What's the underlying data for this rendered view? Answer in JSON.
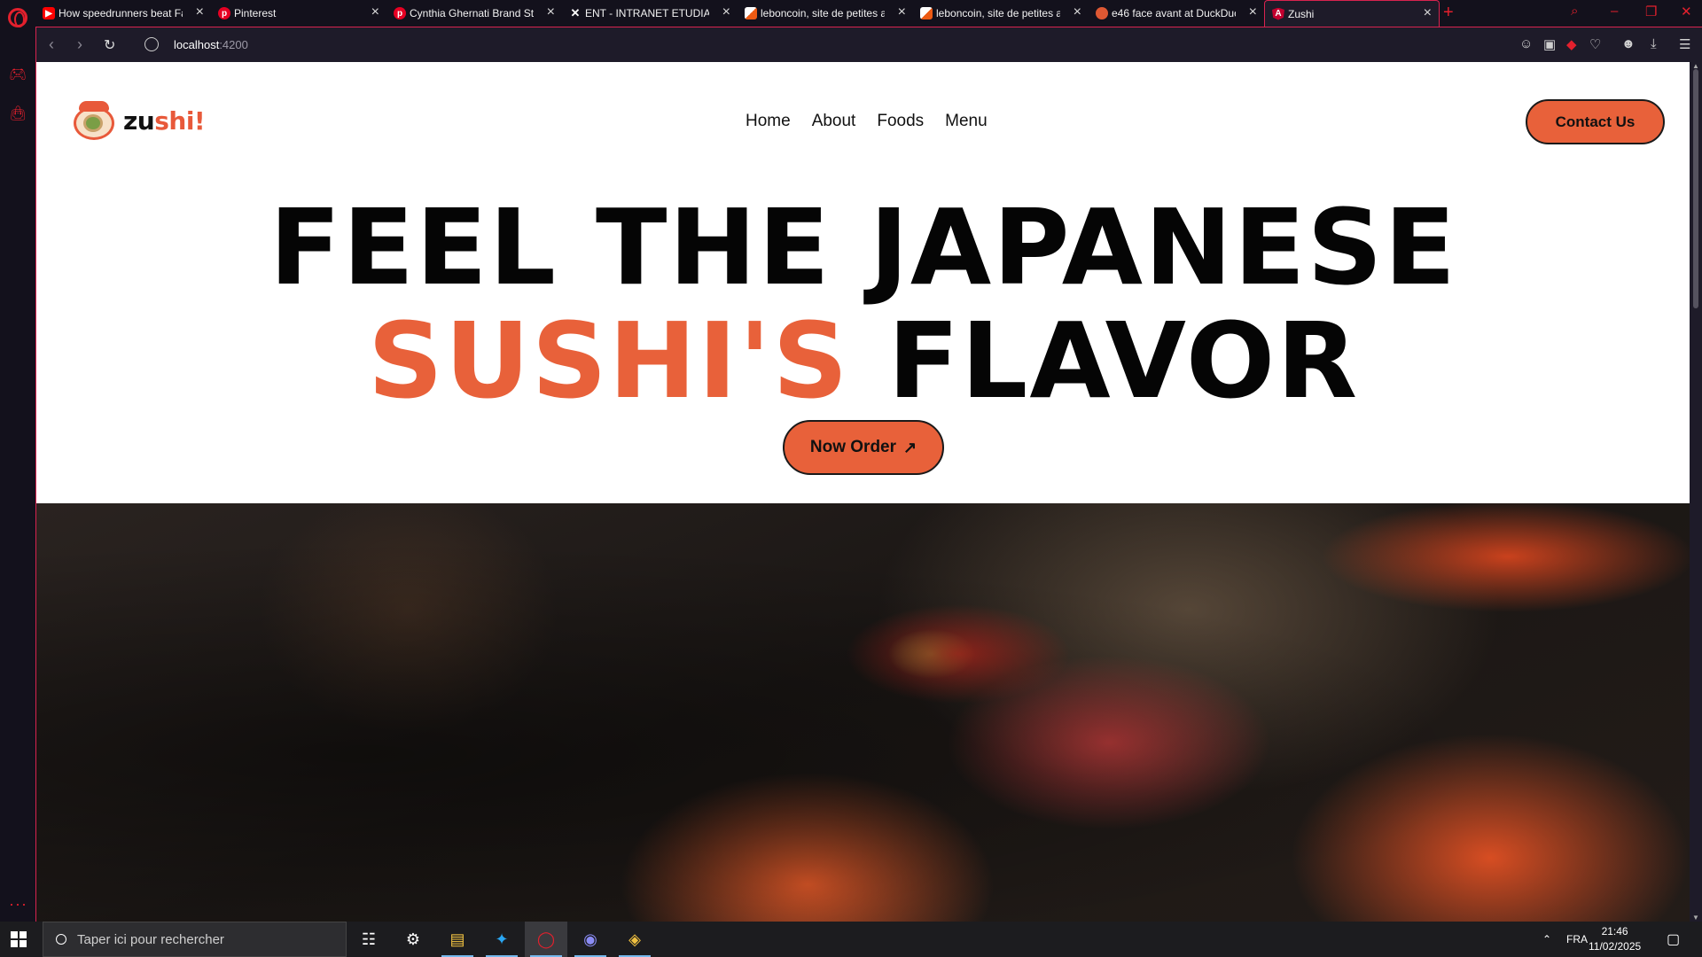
{
  "browser": {
    "tabs": [
      {
        "title": "How speedrunners beat Fa",
        "favicon": "youtube-icon",
        "favicon_color": "#ff0000"
      },
      {
        "title": "Pinterest",
        "favicon": "pinterest-icon",
        "favicon_color": "#e60023"
      },
      {
        "title": "Cynthia Ghernati Brand Str",
        "favicon": "pinterest-icon",
        "favicon_color": "#e60023"
      },
      {
        "title": "ENT - INTRANET ETUDIANT",
        "favicon": "ent-icon",
        "favicon_color": "#ffffff"
      },
      {
        "title": "leboncoin, site de petites a",
        "favicon": "leboncoin-icon",
        "favicon_color": "#ec5a13"
      },
      {
        "title": "leboncoin, site de petites a",
        "favicon": "leboncoin-icon",
        "favicon_color": "#ec5a13"
      },
      {
        "title": "e46 face avant at DuckDuc",
        "favicon": "duckduckgo-icon",
        "favicon_color": "#de5833"
      },
      {
        "title": "Zushi",
        "favicon": "angular-icon",
        "favicon_color": "#c3002f"
      }
    ],
    "url_host": "localhost",
    "url_port": ":4200"
  },
  "site": {
    "logo_part1": "zu",
    "logo_part2": "shi!",
    "nav": [
      "Home",
      "About",
      "Foods",
      "Menu"
    ],
    "contact_label": "Contact Us",
    "hero_line1": "FEEL THE JAPANESE",
    "hero_accent": "SUSHI'S",
    "hero_rest": "FLAVOR",
    "order_label": "Now Order",
    "accent_color": "#e8613a"
  },
  "taskbar": {
    "search_placeholder": "Taper ici pour rechercher",
    "language": "FRA",
    "time": "21:46",
    "date": "11/02/2025"
  }
}
